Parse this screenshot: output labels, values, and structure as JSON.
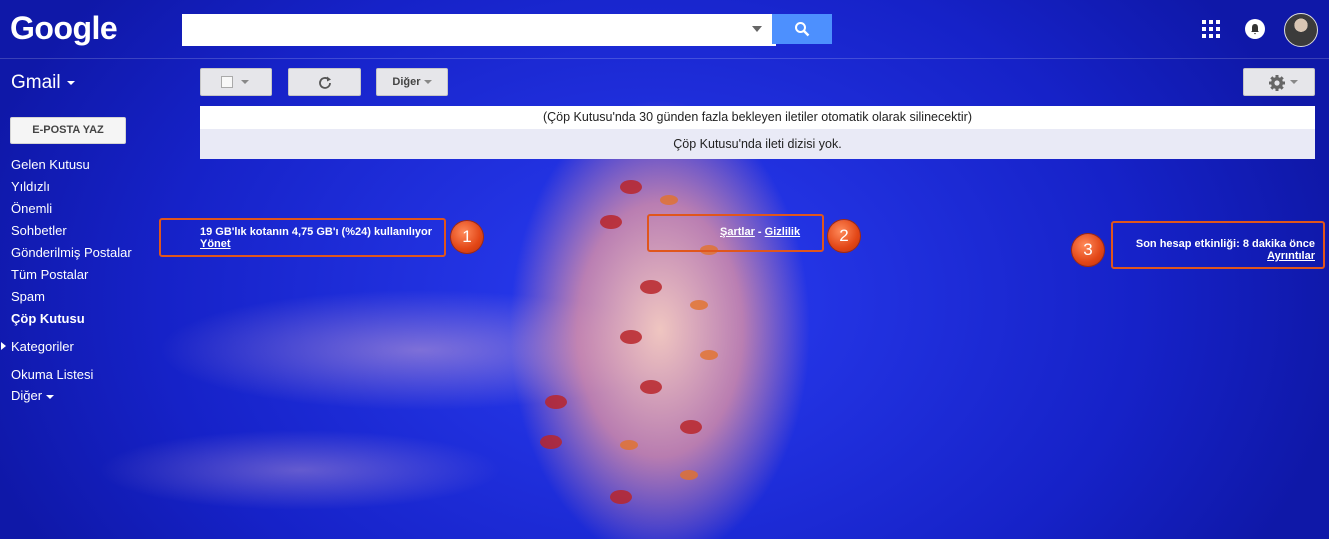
{
  "header": {
    "logo": "Google",
    "search": {
      "value": "",
      "placeholder": ""
    },
    "icons": [
      "search-icon",
      "apps-grid-icon",
      "notifications-bell-icon",
      "avatar"
    ]
  },
  "sidebar": {
    "app_name": "Gmail",
    "compose_label": "E-POSTA YAZ",
    "items": [
      {
        "label": "Gelen Kutusu"
      },
      {
        "label": "Yıldızlı"
      },
      {
        "label": "Önemli"
      },
      {
        "label": "Sohbetler"
      },
      {
        "label": "Gönderilmiş Postalar"
      },
      {
        "label": "Tüm Postalar"
      },
      {
        "label": "Spam"
      },
      {
        "label": "Çöp Kutusu",
        "active": true
      },
      {
        "label": "Kategoriler"
      },
      {
        "label": "Okuma Listesi"
      },
      {
        "label": "Diğer"
      }
    ]
  },
  "toolbar": {
    "more_label": "Diğer"
  },
  "main": {
    "notice": "(Çöp Kutusu'nda 30 günden fazla bekleyen iletiler otomatik olarak silinecektir)",
    "empty_message": "Çöp Kutusu'nda ileti dizisi yok."
  },
  "footer": {
    "storage_text": "19 GB'lık kotanın 4,75 GB'ı (%24) kullanılıyor",
    "manage_link": "Yönet",
    "terms_link": "Şartlar",
    "separator": "-",
    "privacy_link": "Gizlilik",
    "activity_text": "Son hesap etkinliği: 8 dakika önce",
    "details_link": "Ayrıntılar"
  },
  "annotations": [
    "1",
    "2",
    "3"
  ],
  "colors": {
    "background": "#1a1fd8",
    "search_button": "#4d90fe",
    "annotation": "#e0561c"
  }
}
